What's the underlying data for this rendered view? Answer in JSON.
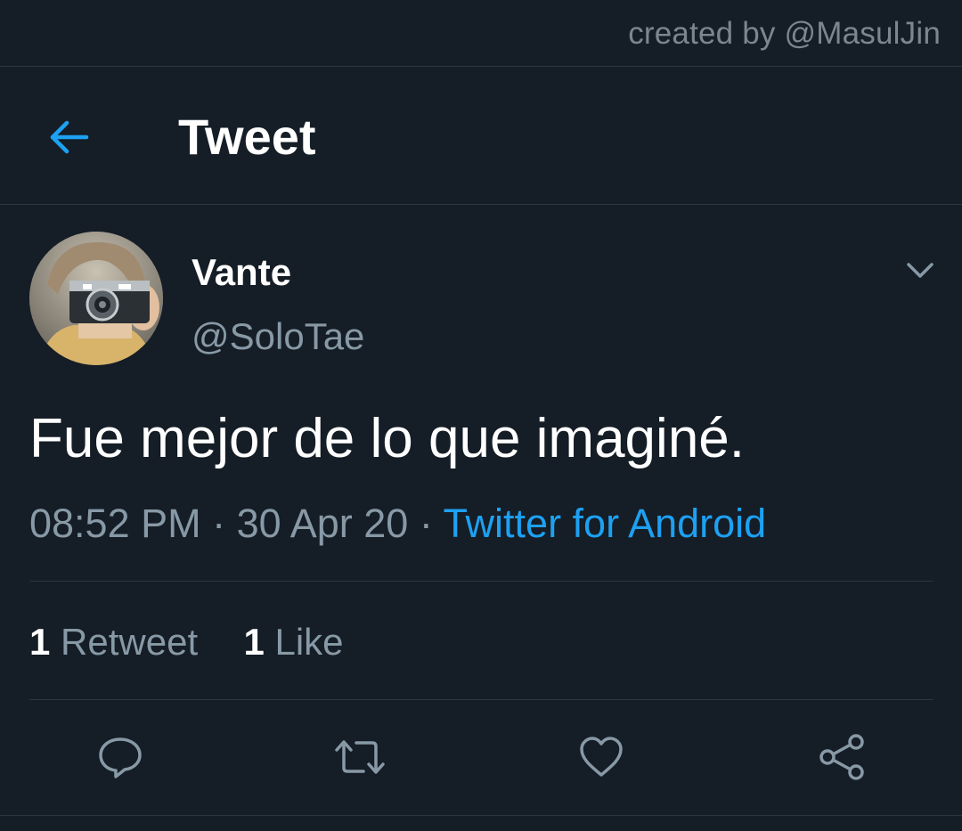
{
  "credit": "created by @MasulJin",
  "header": {
    "title": "Tweet",
    "back_icon": "arrow-left-icon"
  },
  "colors": {
    "background": "#151d26",
    "accent": "#1da1f2",
    "secondary_text": "#8899a6",
    "primary_text": "#ffffff",
    "divider": "#2c3640"
  },
  "tweet": {
    "display_name": "Vante",
    "handle": "@SoloTae",
    "text": "Fue mejor de lo que imaginé.",
    "time": "08:52 PM",
    "separator": "·",
    "date": "30 Apr 20",
    "source": "Twitter for Android",
    "menu_icon": "chevron-down-icon"
  },
  "stats": {
    "retweets_count": "1",
    "retweets_label": "Retweet",
    "likes_count": "1",
    "likes_label": "Like"
  },
  "actions": [
    {
      "name": "reply",
      "icon": "reply-icon"
    },
    {
      "name": "retweet",
      "icon": "retweet-icon"
    },
    {
      "name": "like",
      "icon": "heart-icon"
    },
    {
      "name": "share",
      "icon": "share-icon"
    }
  ]
}
